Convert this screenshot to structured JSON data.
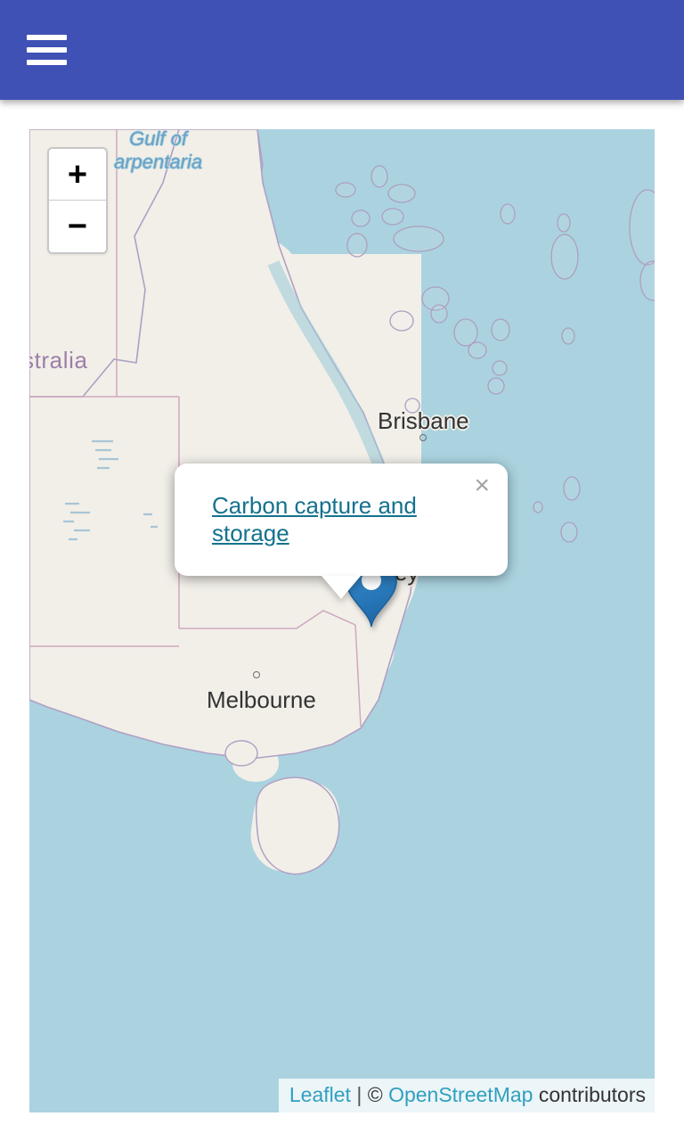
{
  "header": {
    "menu_button_label": "Menu",
    "icon": "hamburger-menu-icon",
    "background_color": "#3f51b5"
  },
  "map": {
    "provider": "leaflet",
    "tile_land_color": "#f2efe9",
    "tile_water_color": "#aad3df",
    "zoom_control": {
      "zoom_in_label": "+",
      "zoom_in_title": "Zoom in",
      "zoom_out_label": "−",
      "zoom_out_title": "Zoom out"
    },
    "labels": {
      "sea": "Gulf of\nCarpentaria",
      "sea_line1": "Gulf of",
      "sea_line2": "arpentaria",
      "country": "stralia",
      "city_brisbane": "Brisbane",
      "city_sydney": "ydney",
      "city_melbourne": "Melbourne"
    },
    "marker": {
      "icon": "map-pin-icon",
      "color": "#2b7cc0"
    },
    "popup": {
      "link_text": "Carbon capture and storage",
      "link_color": "#14728e",
      "close_label": "×"
    },
    "attribution": {
      "leaflet": "Leaflet",
      "separator": "|",
      "copyright": "©",
      "osm": "OpenStreetMap",
      "contributors": "contributors"
    }
  }
}
